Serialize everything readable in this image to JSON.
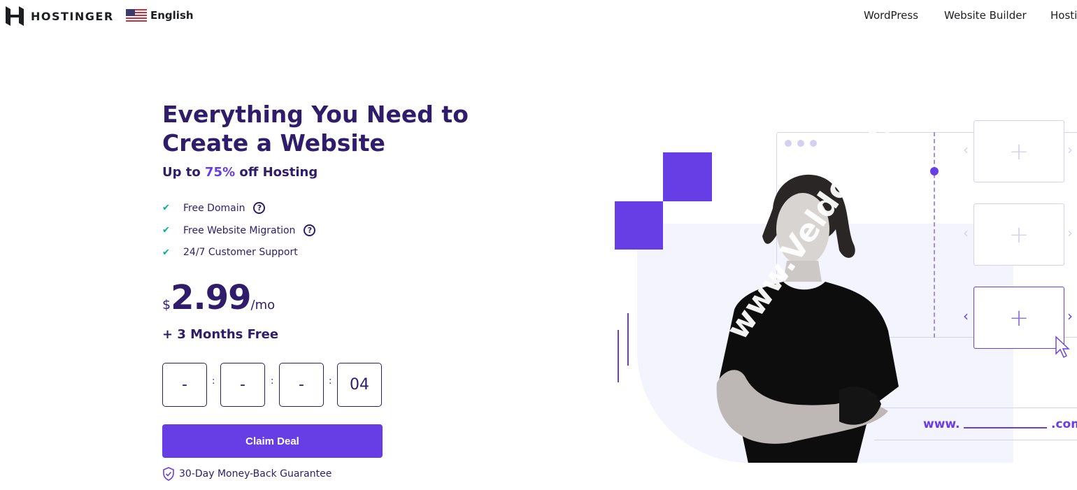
{
  "header": {
    "brand": "HOSTINGER",
    "language": "English",
    "nav": [
      "WordPress",
      "Website Builder",
      "Hosti"
    ]
  },
  "hero": {
    "title": "Everything You Need to Create a Website",
    "subtitle_prefix": "Up to ",
    "subtitle_discount": "75%",
    "subtitle_suffix": " off Hosting",
    "features": [
      {
        "label": "Free Domain",
        "help": true
      },
      {
        "label": "Free Website Migration",
        "help": true
      },
      {
        "label": "24/7 Customer Support",
        "help": false
      }
    ],
    "currency": "$",
    "price": "2.99",
    "period": "/mo",
    "bonus": "+ 3 Months Free",
    "countdown": [
      "-",
      "-",
      "-",
      "04"
    ],
    "cta": "Claim Deal",
    "guarantee": "30-Day Money-Back Guarantee"
  },
  "illustration": {
    "domain_prefix": "www.",
    "domain_suffix": ".com",
    "watermark": "www.Veldc.com"
  },
  "colors": {
    "primary": "#673de6",
    "text": "#2f1c6a",
    "check": "#00b090",
    "panel": "#f4f4ff"
  }
}
